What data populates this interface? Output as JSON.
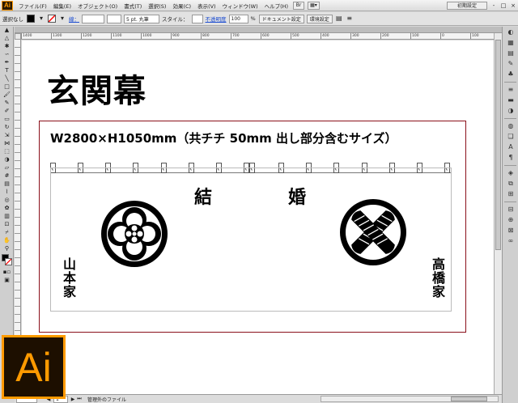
{
  "app": {
    "logo_text": "Ai",
    "menu": [
      "ファイル(F)",
      "編集(E)",
      "オブジェクト(O)",
      "書式(T)",
      "選択(S)",
      "効果(C)",
      "表示(V)",
      "ウィンドウ(W)",
      "ヘルプ(H)"
    ],
    "workspace_label": "初期設定",
    "window_controls": [
      "-",
      "□",
      "×"
    ]
  },
  "controlbar": {
    "selection_label": "選択なし",
    "stroke_label": "線：",
    "stroke_weight_value": "",
    "brush_value": "5 pt. 丸筆",
    "style_label": "スタイル：",
    "opacity_link": "不透明度",
    "opacity_value": "100",
    "opacity_unit": "%",
    "doc_settings_button": "ドキュメント設定",
    "prefs_button": "環境設定",
    "colors": {
      "fill": "#000000",
      "stroke": "#ff0000"
    }
  },
  "document": {
    "tab_label": "",
    "ruler_ticks": [
      "1400",
      "1300",
      "1200",
      "1100",
      "1000",
      "900",
      "800",
      "700",
      "600",
      "500",
      "400",
      "300",
      "200",
      "100",
      "0",
      "100",
      "200",
      "300",
      "400",
      "500"
    ],
    "status": {
      "zoom": "",
      "page": "1",
      "status_text": "管理外のファイル"
    }
  },
  "artwork": {
    "heading": "玄関幕",
    "dimension_text": "W2800×H1050mm（共チチ 50mm 出し部分含むサイズ）",
    "center_left": "結",
    "center_right": "婚",
    "family_left": "山本家",
    "family_right": "高橋家",
    "crest_left_icon": "mokko-crest-icon",
    "crest_right_icon": "takanoha-crest-icon",
    "border_color": "#8a0f1a"
  },
  "ai_logo_text": "Ai",
  "icons": {
    "tools": [
      "selection-tool-icon",
      "direct-selection-tool-icon",
      "magic-wand-tool-icon",
      "lasso-tool-icon",
      "pen-tool-icon",
      "type-tool-icon",
      "line-tool-icon",
      "rectangle-tool-icon",
      "paintbrush-tool-icon",
      "pencil-tool-icon",
      "blob-brush-tool-icon",
      "eraser-tool-icon",
      "rotate-tool-icon",
      "scale-tool-icon",
      "width-tool-icon",
      "free-transform-tool-icon",
      "shape-builder-tool-icon",
      "perspective-grid-tool-icon",
      "mesh-tool-icon",
      "gradient-tool-icon",
      "eyedropper-tool-icon",
      "blend-tool-icon",
      "symbol-sprayer-tool-icon",
      "column-graph-tool-icon",
      "artboard-tool-icon",
      "slice-tool-icon",
      "hand-tool-icon",
      "zoom-tool-icon"
    ]
  }
}
